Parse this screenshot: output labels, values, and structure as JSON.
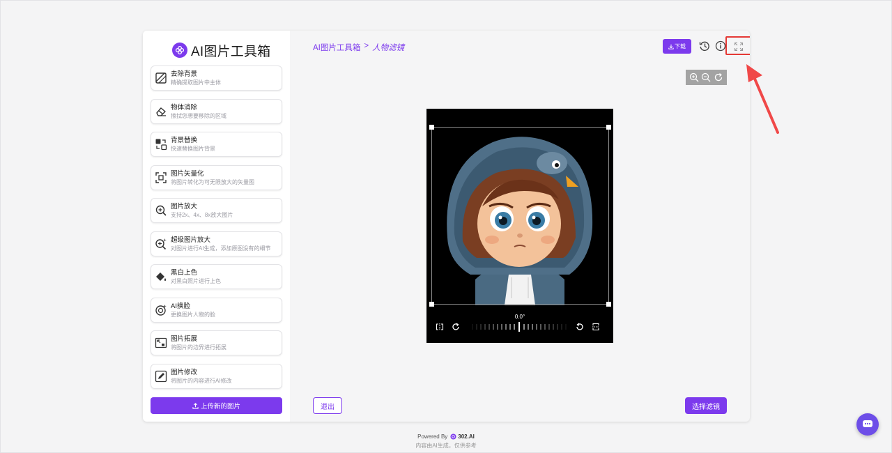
{
  "brand": {
    "title": "AI图片工具箱"
  },
  "tools": [
    {
      "name": "去除背景",
      "desc": "精确提取图片中主体",
      "icon": "remove-bg-icon"
    },
    {
      "name": "物体消除",
      "desc": "擦拭您想要移除的区域",
      "icon": "eraser-icon"
    },
    {
      "name": "背景替换",
      "desc": "快速替换图片背景",
      "icon": "replace-bg-icon"
    },
    {
      "name": "图片矢量化",
      "desc": "将图片转化为可无限放大的矢量图",
      "icon": "vector-icon"
    },
    {
      "name": "图片放大",
      "desc": "支持2x、4x、8x放大图片",
      "icon": "zoom-in-icon"
    },
    {
      "name": "超级图片放大",
      "desc": "对图片进行AI生成，添加原图没有的细节",
      "icon": "super-zoom-icon"
    },
    {
      "name": "黑白上色",
      "desc": "对黑白照片进行上色",
      "icon": "paint-bucket-icon"
    },
    {
      "name": "AI换脸",
      "desc": "更换图片人物的脸",
      "icon": "face-swap-icon"
    },
    {
      "name": "图片拓展",
      "desc": "将图片的边界进行拓展",
      "icon": "expand-image-icon"
    },
    {
      "name": "图片修改",
      "desc": "将图片的内容进行AI修改",
      "icon": "edit-image-icon"
    }
  ],
  "upload": {
    "label": "上传新的图片"
  },
  "breadcrumb": {
    "root": "AI图片工具箱",
    "separator": ">",
    "current": "人物滤镜"
  },
  "header": {
    "download_label": "下载"
  },
  "editor": {
    "angle": "0.0°"
  },
  "actions": {
    "exit_label": "退出",
    "filter_label": "选择滤镜"
  },
  "footer": {
    "powered_by": "Powered By",
    "brand": "302.AI",
    "disclaimer": "内容由AI生成，仅供参考"
  },
  "colors": {
    "accent": "#7c3aed",
    "highlight": "#e53935"
  }
}
